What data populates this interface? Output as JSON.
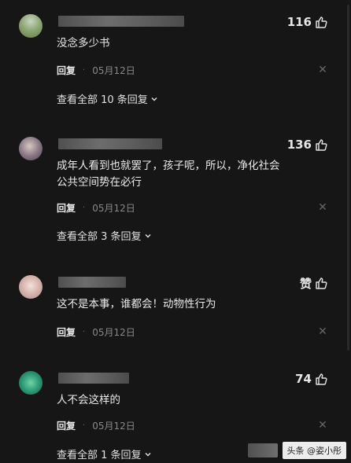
{
  "comments": [
    {
      "likes": "116",
      "text": "没念多少书",
      "reply_label": "回复",
      "date": "05月12日",
      "view_all": "查看全部 10 条回复"
    },
    {
      "likes": "136",
      "text": "成年人看到也就罢了，孩子呢，所以，净化社会公共空间势在必行",
      "reply_label": "回复",
      "date": "05月12日",
      "view_all": "查看全部 3 条回复"
    },
    {
      "likes": "赞",
      "text": "这不是本事，谁都会！动物性行为",
      "reply_label": "回复",
      "date": "05月12日"
    },
    {
      "likes": "74",
      "text": "人不会这样的",
      "reply_label": "回复",
      "date": "05月12日",
      "view_all": "查看全部 1 条回复"
    }
  ],
  "separator": "·",
  "watermark": "头条 @姿小彤",
  "icons": {
    "like": "thumbs-up-icon",
    "close": "close-icon",
    "chevron": "chevron-down-icon"
  }
}
